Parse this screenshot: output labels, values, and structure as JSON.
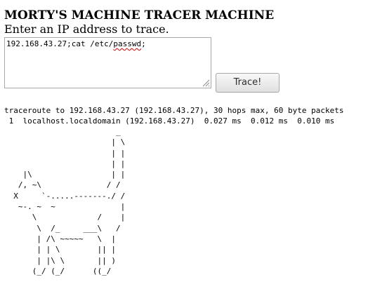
{
  "page": {
    "title": "MORTY'S MACHINE TRACER MACHINE",
    "subtitle": "Enter an IP address to trace."
  },
  "form": {
    "input_prefix": "192.168.43.27;cat /etc/",
    "input_misspelled": "passwd",
    "input_suffix": ";",
    "button_label": "Trace!",
    "spellcheck_underline_color": "#d40000"
  },
  "output": {
    "lines": [
      "traceroute to 192.168.43.27 (192.168.43.27), 30 hops max, 60 byte packets",
      " 1  localhost.localdomain (192.168.43.27)  0.027 ms  0.012 ms  0.010 ms"
    ]
  },
  "ascii_art": {
    "lines": [
      "                        _",
      "                       | \\",
      "                       | |",
      "                       | |",
      "    |\\                 | |",
      "   /, ~\\              / /",
      "  X     `-.....-------./ /",
      "   ~-. ~  ~              |",
      "      \\             /    |",
      "       \\  /_     ___\\   /",
      "       | /\\ ~~~~~   \\  |",
      "       | | \\        || |",
      "       | |\\ \\       || )",
      "      (_/ (_/      ((_/"
    ]
  }
}
